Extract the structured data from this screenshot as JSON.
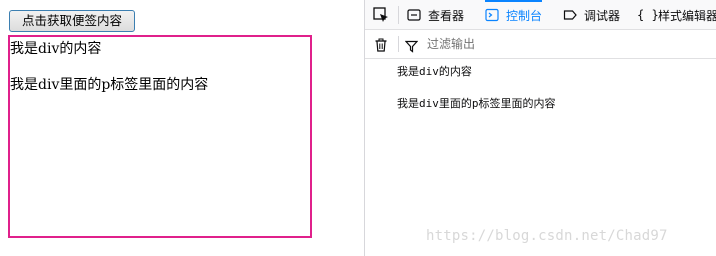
{
  "page": {
    "button_label": "点击获取便签内容",
    "div_text": "我是div的内容",
    "p_text": "我是div里面的p标签里面的内容",
    "box_border_color": "#e0208b"
  },
  "devtools": {
    "tabs": [
      {
        "label": "查看器",
        "icon": "inspector-icon",
        "selected": false
      },
      {
        "label": "控制台",
        "icon": "console-icon",
        "selected": true
      },
      {
        "label": "调试器",
        "icon": "debugger-icon",
        "selected": false
      },
      {
        "label": "样式编辑器",
        "icon": "style-editor-icon",
        "selected": false
      }
    ],
    "filter_placeholder": "过滤输出",
    "console_messages": [
      "我是div的内容",
      "我是div里面的p标签里面的内容"
    ],
    "accent_color": "#0a84ff"
  },
  "watermark": "https://blog.csdn.net/Chad97"
}
